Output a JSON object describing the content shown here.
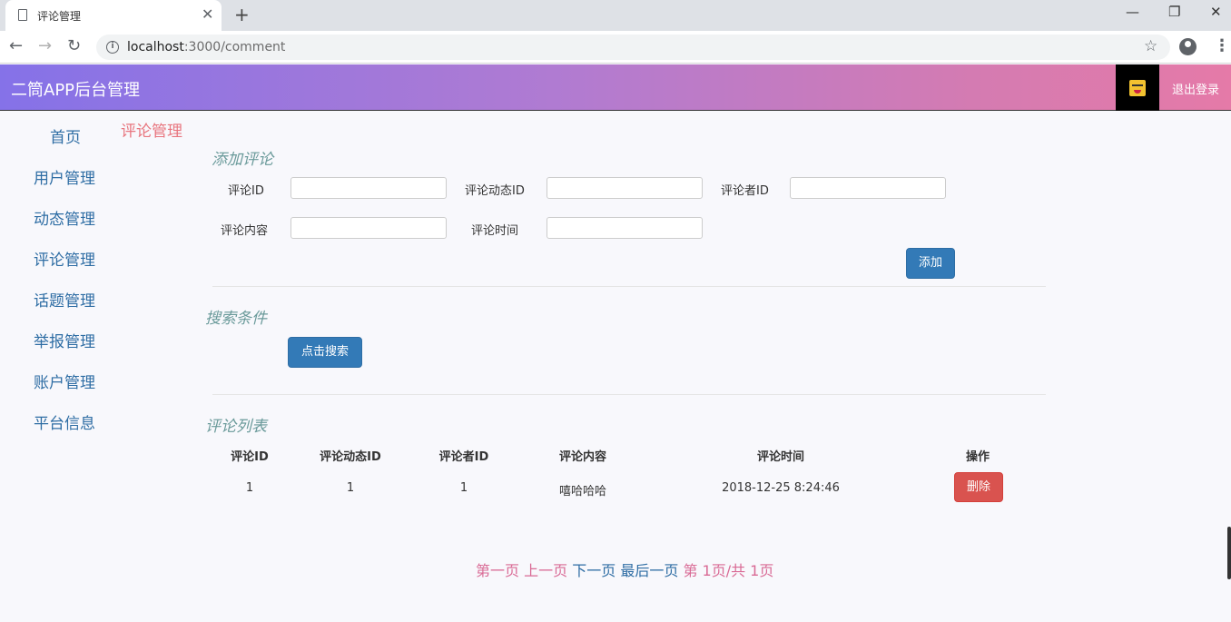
{
  "browser": {
    "tab_title": "评论管理",
    "url_host": "localhost",
    "url_path": ":3000/comment"
  },
  "header": {
    "app_title": "二筒APP后台管理",
    "logout": "退出登录"
  },
  "sidebar": {
    "items": [
      "首页",
      "用户管理",
      "动态管理",
      "评论管理",
      "话题管理",
      "举报管理",
      "账户管理",
      "平台信息"
    ]
  },
  "breadcrumb": "评论管理",
  "add_form": {
    "title": "添加评论",
    "labels": {
      "comment_id": "评论ID",
      "post_id": "评论动态ID",
      "commenter_id": "评论者ID",
      "content": "评论内容",
      "time": "评论时间"
    },
    "values": {
      "comment_id": "",
      "post_id": "",
      "commenter_id": "",
      "content": "",
      "time": ""
    },
    "submit": "添加"
  },
  "search": {
    "title": "搜索条件",
    "button": "点击搜索"
  },
  "list": {
    "title": "评论列表",
    "columns": [
      "评论ID",
      "评论动态ID",
      "评论者ID",
      "评论内容",
      "评论时间",
      "操作"
    ],
    "rows": [
      {
        "id": "1",
        "post_id": "1",
        "commenter_id": "1",
        "content": "嘻哈哈哈",
        "time": "2018-12-25 8:24:46",
        "action": "删除"
      }
    ]
  },
  "pagination": {
    "first": "第一页",
    "prev": "上一页",
    "next": "下一页",
    "last": "最后一页",
    "status": "第 1页/共 1页"
  }
}
